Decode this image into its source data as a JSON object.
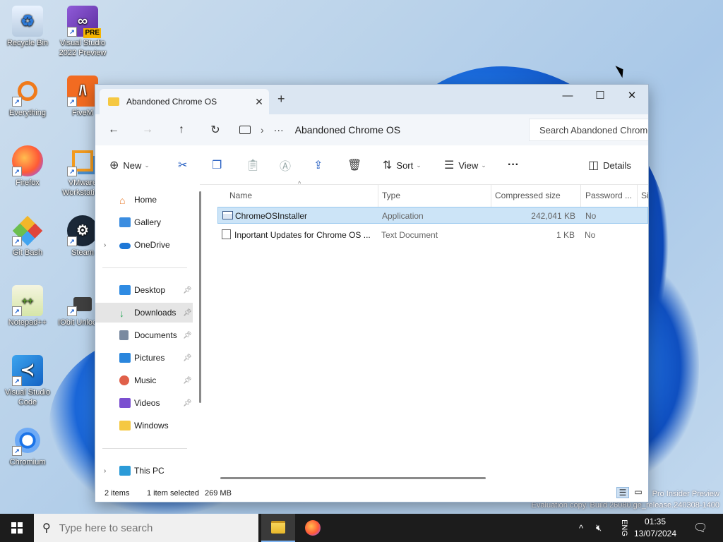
{
  "desktop": {
    "icons": [
      {
        "label": "Recycle Bin"
      },
      {
        "label": "Visual Studio 2022 Preview",
        "badge": "PRE"
      },
      {
        "label": "Everything"
      },
      {
        "label": "FiveM"
      },
      {
        "label": "Firefox"
      },
      {
        "label": "VMware Workstation"
      },
      {
        "label": "Git Bash"
      },
      {
        "label": "Steam"
      },
      {
        "label": "Notepad++"
      },
      {
        "label": "IObit Unlocker"
      },
      {
        "label": "Visual Studio Code"
      },
      {
        "label": "Chromium"
      }
    ],
    "watermark_line1": "Pro Insider Preview",
    "watermark_line2": "Evaluation copy. Build 26080.ge_release.240308-1400"
  },
  "window": {
    "tab_title": "Abandoned Chrome OS",
    "new_tab": "+",
    "minimize": "—",
    "maximize": "☐",
    "close": "✕",
    "address": {
      "more": "···",
      "crumb": "Abandoned Chrome OS"
    },
    "search_placeholder": "Search Abandoned Chrome OS",
    "toolbar": {
      "new_label": "New",
      "sort_label": "Sort",
      "view_label": "View",
      "more_label": "···",
      "details_label": "Details"
    },
    "nav": {
      "home": "Home",
      "gallery": "Gallery",
      "onedrive": "OneDrive",
      "desktop": "Desktop",
      "downloads": "Downloads",
      "documents": "Documents",
      "pictures": "Pictures",
      "music": "Music",
      "videos": "Videos",
      "windows": "Windows",
      "thispc": "This PC"
    },
    "columns": {
      "name": "Name",
      "type": "Type",
      "compressed_size": "Compressed size",
      "password": "Password ...",
      "size": "Si"
    },
    "files": [
      {
        "name": "ChromeOSInstaller",
        "type": "Application",
        "compressed": "242,041 KB",
        "password": "No"
      },
      {
        "name": "Inportant Updates for Chrome OS ...",
        "type": "Text Document",
        "compressed": "1 KB",
        "password": "No"
      }
    ],
    "status": {
      "count": "2 items",
      "selected": "1 item selected",
      "size": "269 MB"
    }
  },
  "taskbar": {
    "search_placeholder": "Type here to search",
    "lang": "ENG",
    "time": "01:35",
    "date": "13/07/2024"
  },
  "colors": {
    "accent": "#2b63c4",
    "selection": "#cce4f7",
    "taskbar": "#1c1c1c"
  }
}
